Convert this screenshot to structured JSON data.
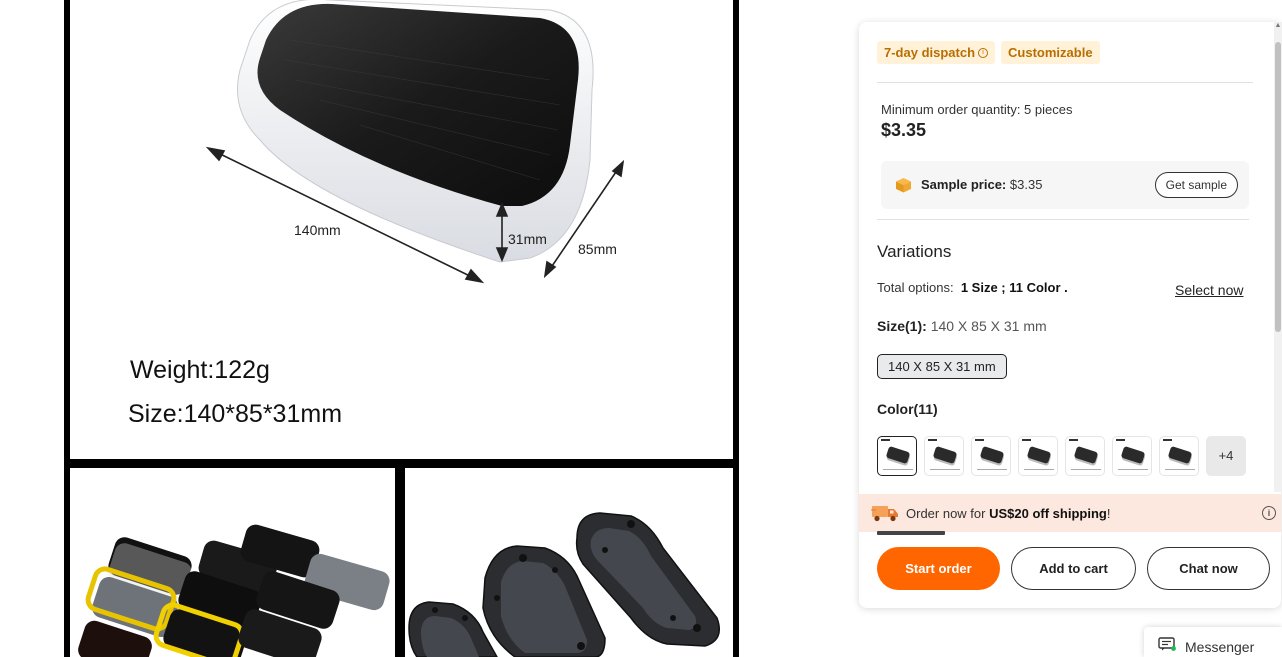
{
  "gallery": {
    "main_image": {
      "length_label": "140mm",
      "height_label": "31mm",
      "width_label": "85mm",
      "weight_text": "Weight:122g",
      "size_text": "Size:140*85*31mm"
    }
  },
  "product": {
    "tags": [
      "7-day dispatch",
      "Customizable"
    ],
    "min_order": "Minimum order quantity: 5 pieces",
    "price": "$3.35",
    "sample": {
      "label": "Sample price:",
      "value": "$3.35",
      "button": "Get sample"
    },
    "variations": {
      "heading": "Variations",
      "total_prefix": "Total options:",
      "total_value": "1 Size ; 11 Color .",
      "select_now": "Select now",
      "size_label": "Size(1):",
      "size_value": "140 X 85 X 31 mm",
      "size_option": "140 X 85 X 31 mm",
      "color_label": "Color(11)",
      "more_colors": "+4"
    },
    "shipping": {
      "prefix": "Order now for ",
      "highlight": "US$20 off shipping",
      "suffix": "!"
    },
    "actions": {
      "start_order": "Start order",
      "add_to_cart": "Add to cart",
      "chat_now": "Chat now"
    }
  },
  "messenger": {
    "label": "Messenger"
  },
  "colors": {
    "accent": "#ff6600",
    "tag_bg": "#fff2d9",
    "tag_text": "#b86e00",
    "shipping_bg": "#fde8df"
  }
}
